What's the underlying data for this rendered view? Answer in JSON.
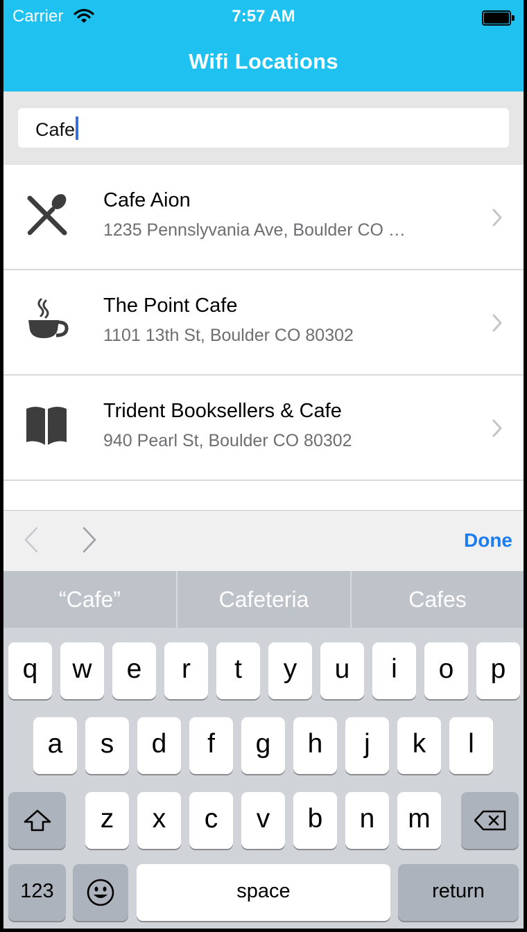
{
  "status_bar": {
    "carrier": "Carrier",
    "time": "7:57 AM",
    "wifi_icon": "wifi-icon",
    "battery_icon": "battery-icon"
  },
  "nav": {
    "title": "Wifi Locations"
  },
  "search": {
    "value": "Cafe"
  },
  "locations": [
    {
      "name": "Cafe Aion",
      "address": "1235 Pennslyvania Ave, Boulder CO …",
      "icon": "restaurant-icon"
    },
    {
      "name": "The Point Cafe",
      "address": "1101 13th St, Boulder CO 80302",
      "icon": "coffee-cup-icon"
    },
    {
      "name": "Trident Booksellers & Cafe",
      "address": "940 Pearl St, Boulder CO 80302",
      "icon": "book-icon"
    }
  ],
  "accessory_bar": {
    "done_label": "Done"
  },
  "keyboard": {
    "suggestions": [
      "“Cafe”",
      "Cafeteria",
      "Cafes"
    ],
    "row1": [
      "q",
      "w",
      "e",
      "r",
      "t",
      "y",
      "u",
      "i",
      "o",
      "p"
    ],
    "row2": [
      "a",
      "s",
      "d",
      "f",
      "g",
      "h",
      "j",
      "k",
      "l"
    ],
    "row3": [
      "z",
      "x",
      "c",
      "v",
      "b",
      "n",
      "m"
    ],
    "numbers_label": "123",
    "space_label": "space",
    "return_label": "return"
  },
  "colors": {
    "header": "#1fc1f0",
    "accent": "#1b7cf0",
    "keyboard_bg": "#d0d3d8"
  }
}
